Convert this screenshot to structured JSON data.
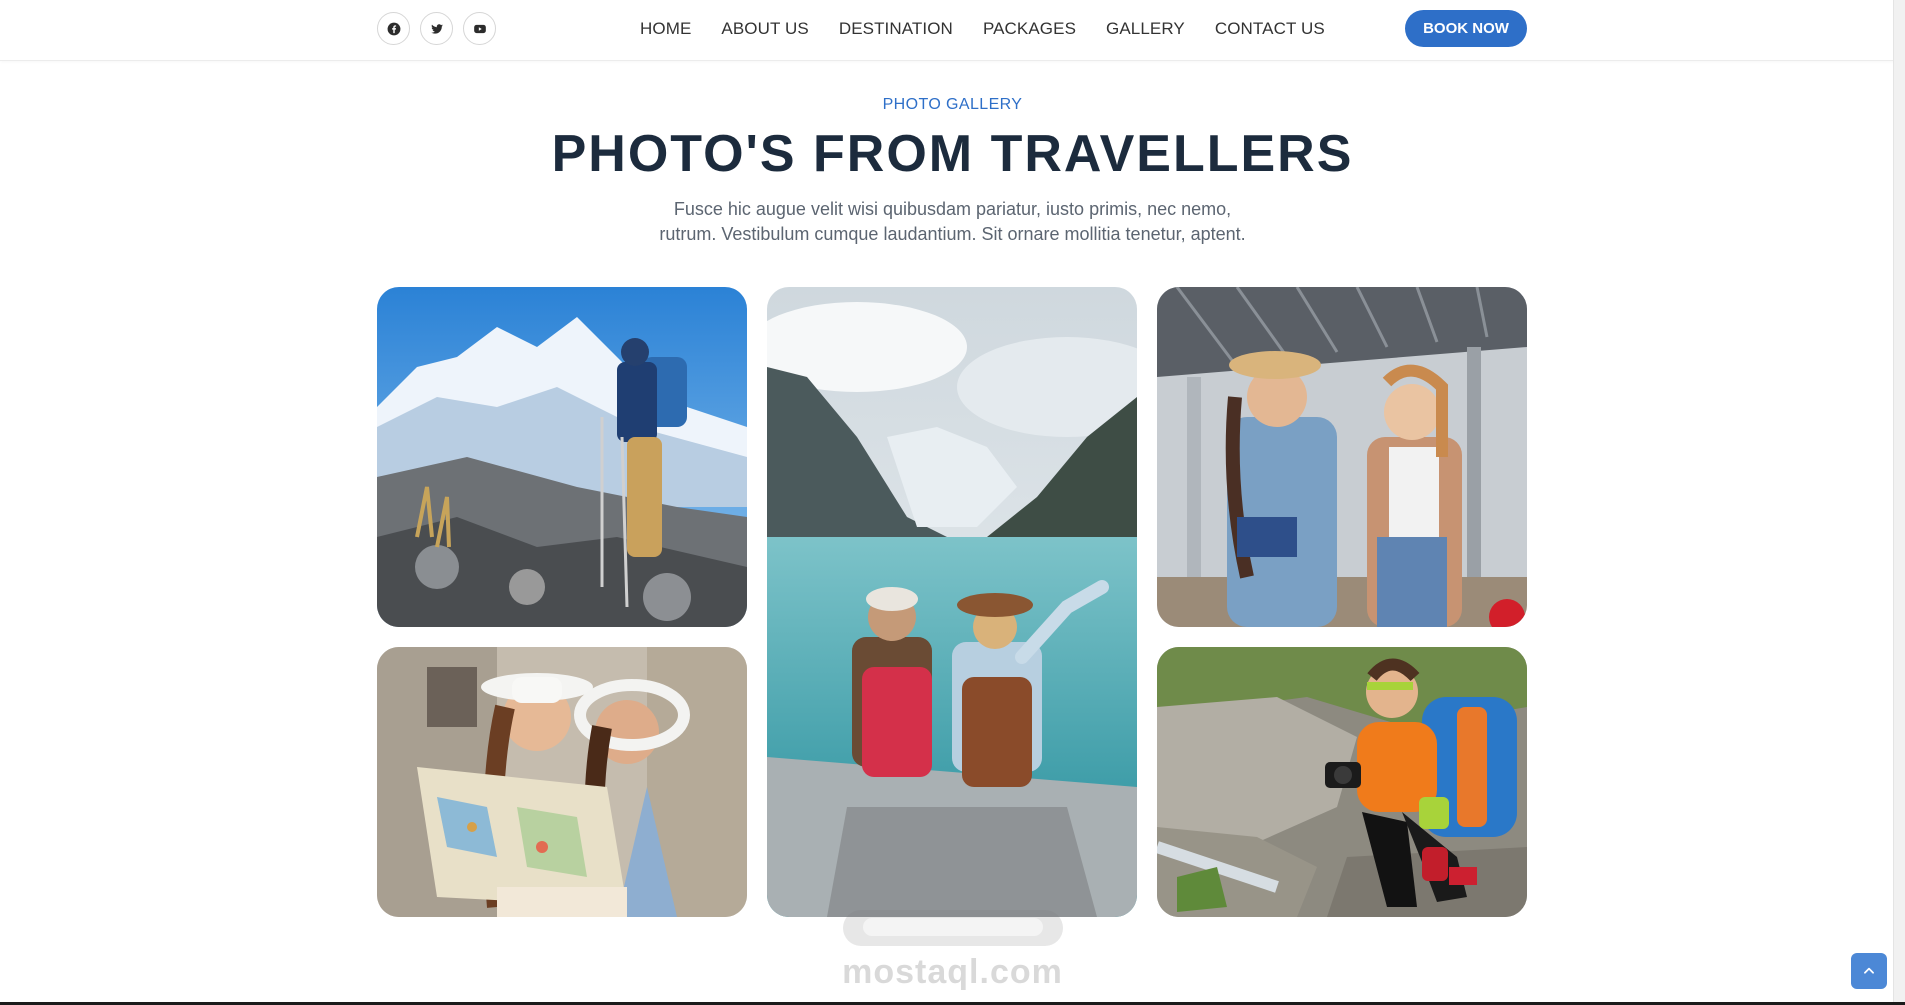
{
  "header": {
    "social": [
      {
        "icon": "facebook-icon"
      },
      {
        "icon": "twitter-icon"
      },
      {
        "icon": "youtube-icon"
      }
    ],
    "nav": [
      "HOME",
      "ABOUT US",
      "DESTINATION",
      "PACKAGES",
      "GALLERY",
      "CONTACT US"
    ],
    "book_label": "BOOK NOW"
  },
  "section": {
    "eyebrow": "PHOTO GALLERY",
    "title": "PHOTO'S FROM TRAVELLERS",
    "desc_line1": "Fusce hic augue velit wisi quibusdam pariatur, iusto primis, nec nemo,",
    "desc_line2": "rutrum. Vestibulum cumque laudantium. Sit ornare mollitia tenetur, aptent."
  },
  "watermark": {
    "text": "mostaql.com"
  },
  "colors": {
    "accent": "#2e6fc8",
    "title": "#1c2b3d",
    "body": "#5c6571"
  }
}
